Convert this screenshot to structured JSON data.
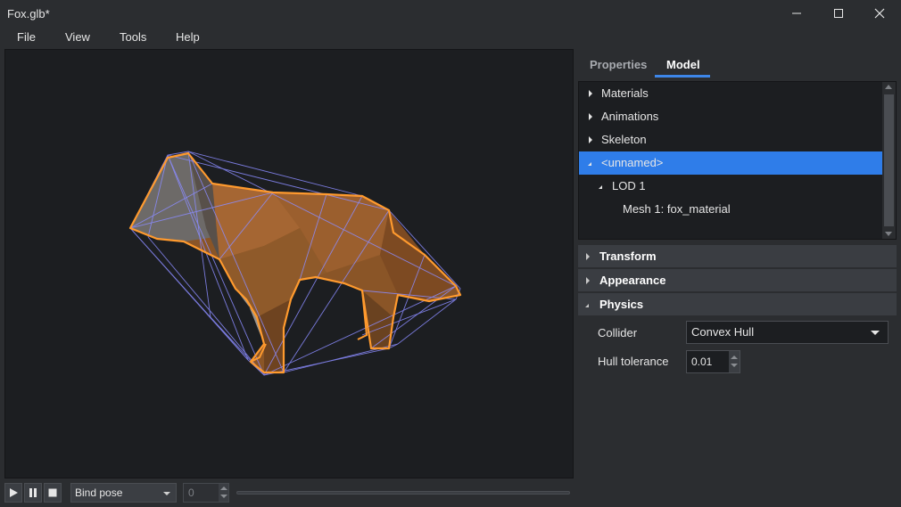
{
  "window": {
    "title": "Fox.glb*"
  },
  "menu": [
    "File",
    "View",
    "Tools",
    "Help"
  ],
  "tabs": {
    "properties": "Properties",
    "model": "Model",
    "active": "Model"
  },
  "tree": [
    {
      "label": "Materials",
      "expanded": false,
      "depth": 0
    },
    {
      "label": "Animations",
      "expanded": false,
      "depth": 0
    },
    {
      "label": "Skeleton",
      "expanded": false,
      "depth": 0
    },
    {
      "label": "<unnamed>",
      "expanded": true,
      "depth": 0,
      "selected": true
    },
    {
      "label": "LOD 1",
      "expanded": true,
      "depth": 1
    },
    {
      "label": "Mesh 1: fox_material",
      "depth": 2
    }
  ],
  "sections": {
    "transform": "Transform",
    "appearance": "Appearance",
    "physics": "Physics"
  },
  "physics": {
    "collider_label": "Collider",
    "collider_value": "Convex Hull",
    "hull_label": "Hull tolerance",
    "hull_value": "0.01"
  },
  "playback": {
    "pose": "Bind pose",
    "frame": "0"
  },
  "colors": {
    "accent": "#2f7de9",
    "outline": "#ff9a2e",
    "hull": "#8b8cff",
    "fox": "#a0622c"
  },
  "icons": [
    "minimize-icon",
    "maximize-icon",
    "close-icon",
    "play-icon",
    "pause-icon",
    "stop-icon",
    "chevron-down-icon"
  ]
}
